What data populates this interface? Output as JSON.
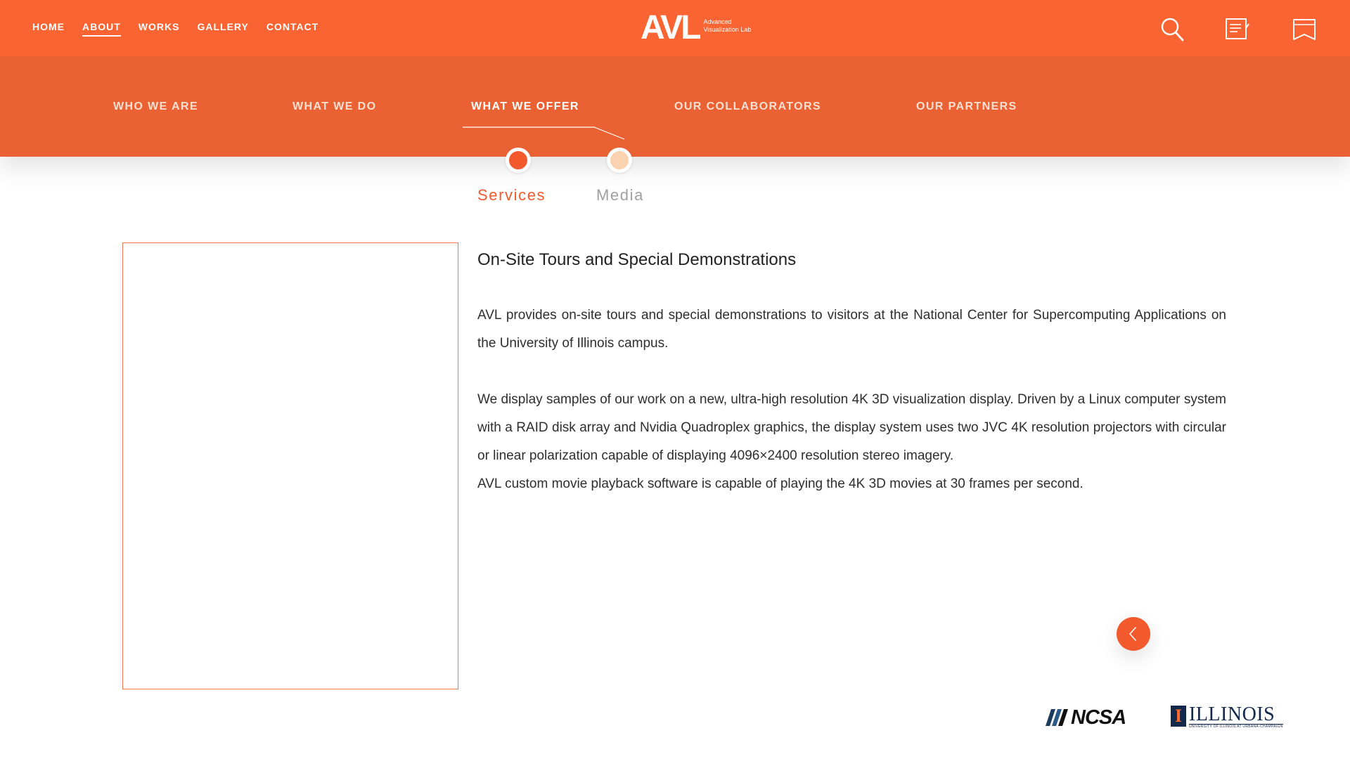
{
  "top_nav": {
    "items": [
      {
        "label": "HOME",
        "active": false
      },
      {
        "label": "ABOUT",
        "active": true
      },
      {
        "label": "WORKS",
        "active": false
      },
      {
        "label": "GALLERY",
        "active": false
      },
      {
        "label": "CONTACT",
        "active": false
      }
    ]
  },
  "logo": {
    "mark": "AVL",
    "line1": "Advanced",
    "line2": "Visualization Lab"
  },
  "top_icons": [
    "search-icon",
    "notes-icon",
    "bookmark-icon"
  ],
  "sub_nav": {
    "items": [
      {
        "label": "WHO WE ARE",
        "active": false
      },
      {
        "label": "WHAT WE DO",
        "active": false
      },
      {
        "label": "WHAT WE OFFER",
        "active": true
      },
      {
        "label": "OUR COLLABORATORS",
        "active": false
      },
      {
        "label": "OUR PARTNERS",
        "active": false
      }
    ]
  },
  "tabs": [
    {
      "label": "Services",
      "active": true
    },
    {
      "label": "Media",
      "active": false
    }
  ],
  "article": {
    "title": "On-Site Tours and Special Demonstrations",
    "p1": "AVL provides on-site tours and special demonstrations to visitors at the National Center for Supercomputing Applications on the University of Illinois campus.",
    "p2": "We display samples of our work on a new, ultra-high resolution 4K 3D visualization display.  Driven by a Linux computer system with a RAID disk array and Nvidia Quadroplex graphics, the display system uses two JVC 4K resolution projectors with circular or linear polarization capable of displaying 4096×2400 resolution stereo imagery.",
    "p3": "AVL custom movie playback software is capable of playing the 4K 3D movies at 30 frames per second."
  },
  "footer_logos": {
    "ncsa": "NCSA",
    "illinois_letter": "I",
    "illinois": "ILLINOIS",
    "illinois_sub": "UNIVERSITY OF ILLINOIS AT URBANA-CHAMPAIGN"
  },
  "colors": {
    "brand_orange": "#f96432",
    "band_orange": "#ea6233",
    "active_tab": "#f25a2e",
    "inactive_tab": "#fbd2b0",
    "inactive_tab_text": "#a0a0a0"
  }
}
